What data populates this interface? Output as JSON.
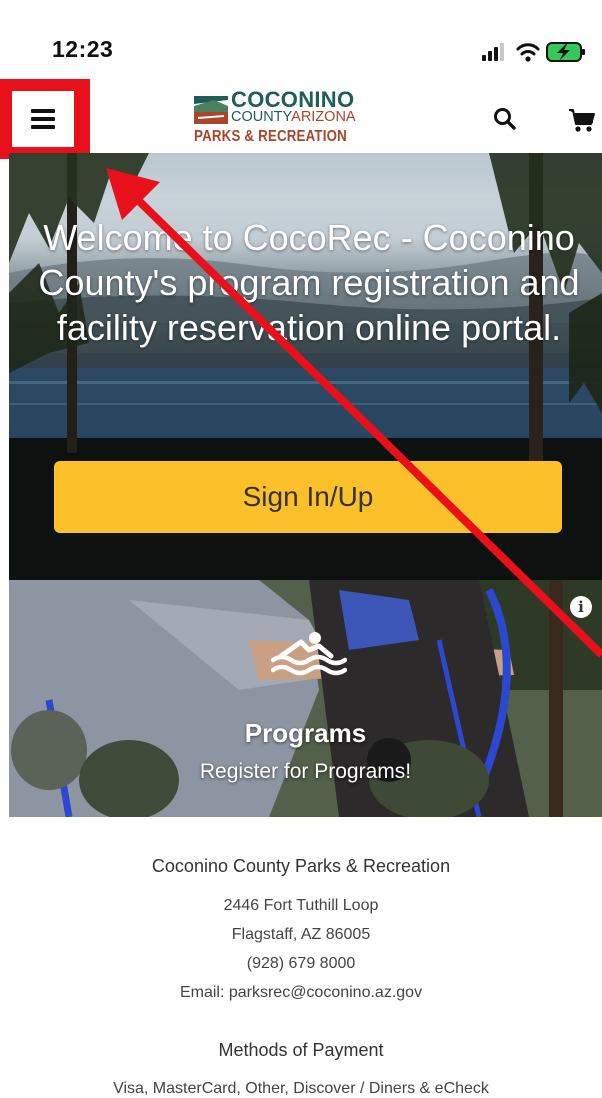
{
  "status_bar": {
    "time": "12:23",
    "icons": [
      "signal-icon",
      "wifi-icon",
      "battery-charging-icon"
    ]
  },
  "header": {
    "logo": {
      "line1": "COCONINO",
      "line2_county": "COUNTY",
      "line2_state": "ARIZONA",
      "line3": "PARKS & RECREATION"
    },
    "icons": [
      "menu-icon",
      "search-icon",
      "cart-icon"
    ]
  },
  "hero": {
    "title": "Welcome to CocoRec - Coconino County's program registration and facility reservation online portal.",
    "sign_in_label": "Sign In/Up"
  },
  "programs_card": {
    "icon": "swimming-icon",
    "info_icon": "info-icon",
    "title": "Programs",
    "subtitle": "Register for Programs!"
  },
  "footer": {
    "org_name": "Coconino County Parks & Recreation",
    "address_line1": "2446 Fort Tuthill Loop",
    "address_line2": "Flagstaff, AZ 86005",
    "phone": "(928) 679 8000",
    "email": "Email: parksrec@coconino.az.gov",
    "payment_title": "Methods of Payment",
    "payment_methods": "Visa, MasterCard, Other, Discover / Diners & eCheck"
  },
  "colors": {
    "accent_button": "#fcc02a",
    "annotation_red": "#e8101a",
    "logo_teal": "#1e5d5a",
    "logo_rust": "#a8452b"
  }
}
